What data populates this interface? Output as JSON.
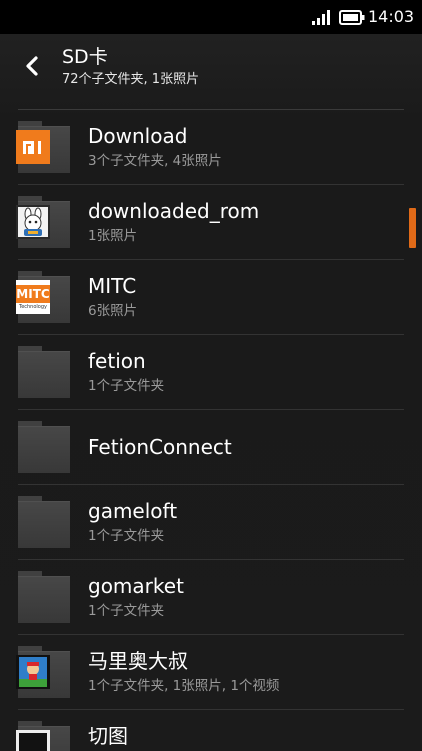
{
  "status_bar": {
    "time": "14:03",
    "icons": [
      "signal-icon",
      "battery-icon"
    ]
  },
  "header": {
    "title": "SD卡",
    "subtitle": "72个子文件夹, 1张照片",
    "back_icon": "chevron-left-icon"
  },
  "folders": [
    {
      "name": "Download",
      "info": "3个子文件夹, 4张照片",
      "thumb": "mi-logo"
    },
    {
      "name": "downloaded_rom",
      "info": "1张照片",
      "thumb": "cartoon-bunny"
    },
    {
      "name": "MITC",
      "info": "6张照片",
      "thumb": "mitc-logo",
      "thumb_text": "MITC",
      "thumb_subtext": "Technology"
    },
    {
      "name": "fetion",
      "info": "1个子文件夹",
      "thumb": ""
    },
    {
      "name": "FetionConnect",
      "info": "",
      "thumb": ""
    },
    {
      "name": "gameloft",
      "info": "1个子文件夹",
      "thumb": ""
    },
    {
      "name": "gomarket",
      "info": "1个子文件夹",
      "thumb": ""
    },
    {
      "name": "马里奥大叔",
      "info": "1个子文件夹, 1张照片, 1个视频",
      "thumb": "mario-video"
    },
    {
      "name": "切图",
      "info": "",
      "thumb": "dark-image"
    }
  ],
  "colors": {
    "accent": "#e06a18",
    "background": "#1b1b1b",
    "secondary_text": "#9a9a9a"
  }
}
